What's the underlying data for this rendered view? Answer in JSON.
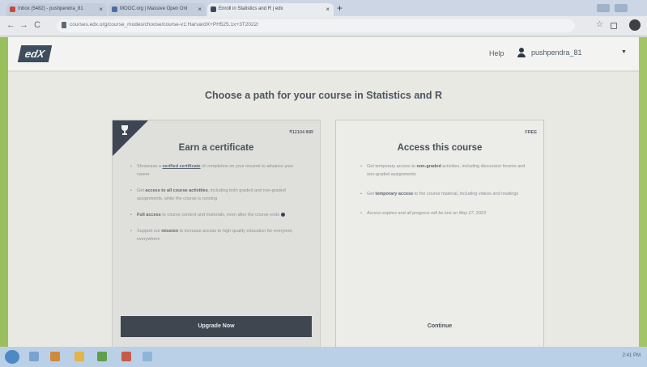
{
  "browser": {
    "tabs": [
      {
        "label": "Inbox (5482) - pushpendra_81",
        "favicon_color": "#c8483a"
      },
      {
        "label": "MOOC.org | Massive Open Onl",
        "favicon_color": "#4a6fa0"
      },
      {
        "label": "Enroll in Statistics and R | edx",
        "favicon_color": "#3a4a5c"
      }
    ],
    "new_tab": "+",
    "url": "courses.edx.org/course_modes/choose/course-v1:HarvardX+PH525.1x+3T2022/",
    "back": "←",
    "forward": "→",
    "reload": "C",
    "star": "☆"
  },
  "header": {
    "logo": "edX",
    "help": "Help",
    "username": "pushpendra_81",
    "caret": "▼"
  },
  "page": {
    "title": "Choose a path for your course in Statistics and R"
  },
  "certificate_card": {
    "price": "₹12104 INR",
    "title": "Earn a certificate",
    "bullets": [
      {
        "pre": "Showcase a ",
        "strong": "verified certificate",
        "post": " of completion on your resumé to advance your career"
      },
      {
        "pre": "Get ",
        "strong": "access to all course activities",
        "post": ", including both graded and non-graded assignments, while the course is running"
      },
      {
        "pre": "",
        "strong": "Full access",
        "post": " to course content and materials, even after the course ends"
      },
      {
        "pre": "Support our ",
        "strong": "mission",
        "post": " to increase access to high-quality education for everyone, everywhere"
      }
    ],
    "button": "Upgrade Now"
  },
  "audit_card": {
    "price": "FREE",
    "title": "Access this course",
    "bullets": [
      {
        "pre": "Get temporary access to ",
        "strong": "non-graded",
        "post": " activities, including discussion forums and non-graded assignments"
      },
      {
        "pre": "Get ",
        "strong": "temporary access",
        "post": " to the course material, including videos and readings"
      },
      {
        "pre": "Access expires and all progress will be lost on May 27, 2023",
        "strong": "",
        "post": ""
      }
    ],
    "button": "Continue"
  },
  "taskbar": {
    "clock": "2:41 PM"
  }
}
